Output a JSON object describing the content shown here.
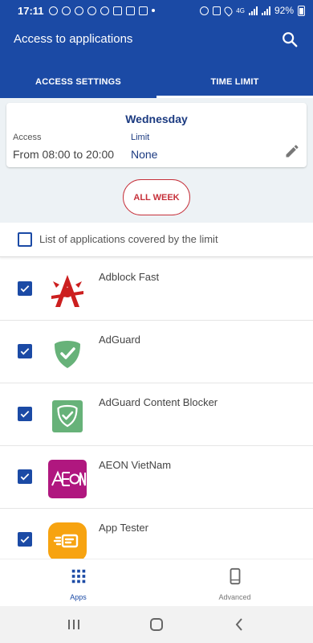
{
  "status_bar": {
    "time": "17:11",
    "network": "4G",
    "battery": "92%"
  },
  "app_bar": {
    "title": "Access to applications",
    "search_icon": "search-icon"
  },
  "tabs": [
    {
      "label": "ACCESS SETTINGS",
      "active": false
    },
    {
      "label": "TIME LIMIT",
      "active": true
    }
  ],
  "day_card": {
    "day": "Wednesday",
    "access_label": "Access",
    "access_value": "From 08:00 to 20:00",
    "limit_label": "Limit",
    "limit_value": "None",
    "edit_icon": "pencil-icon"
  },
  "all_week_button": "ALL WEEK",
  "covered_list": {
    "label": "List of applications covered by the limit",
    "checked": false
  },
  "apps": [
    {
      "name": "Adblock Fast",
      "checked": true,
      "icon": "adblock-fast-icon",
      "color": "#cc1f1f"
    },
    {
      "name": "AdGuard",
      "checked": true,
      "icon": "adguard-icon",
      "color": "#67b279"
    },
    {
      "name": "AdGuard Content Blocker",
      "checked": true,
      "icon": "adguard-content-blocker-icon",
      "color": "#67b279"
    },
    {
      "name": "AEON VietNam",
      "checked": true,
      "icon": "aeon-icon",
      "color": "#b0177f"
    },
    {
      "name": "App Tester",
      "checked": true,
      "icon": "app-tester-icon",
      "color": "#f7a310"
    }
  ],
  "bottom_nav": [
    {
      "label": "Apps",
      "icon": "grid-icon",
      "active": true
    },
    {
      "label": "Advanced",
      "icon": "phone-icon",
      "active": false
    }
  ],
  "colors": {
    "primary": "#1b4aa5",
    "accent_red": "#c6303a",
    "panel_bg": "#edf2f5"
  }
}
